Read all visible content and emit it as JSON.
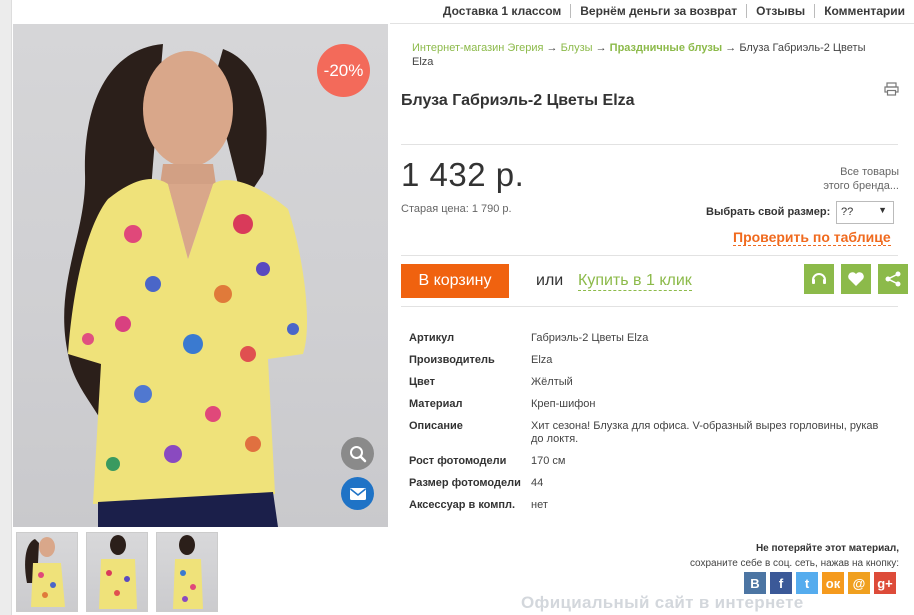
{
  "top_nav": {
    "items": [
      "Доставка 1 классом",
      "Вернём деньги за возврат",
      "Отзывы",
      "Комментарии"
    ]
  },
  "product_image": {
    "discount_badge": "-20%",
    "zoom_icon": "magnifier-icon",
    "mail_icon": "envelope-icon"
  },
  "breadcrumb": {
    "items": [
      "Интернет-магазин Эгерия",
      "Блузы",
      "Праздничные блузы",
      "Блуза Габриэль-2 Цветы"
    ],
    "tail": "Elza",
    "separator": "→"
  },
  "product": {
    "title": "Блуза Габриэль-2 Цветы Elza",
    "price": "1 432 р.",
    "old_price": "Старая цена: 1 790 р.",
    "all_goods_line1": "Все товары",
    "all_goods_line2": "этого бренда...",
    "size_label": "Выбрать свой размер:",
    "size_value": "??",
    "check_table": "Проверить по таблице",
    "cart_button": "В корзину",
    "or_text": "или",
    "one_click": "Купить в 1 клик"
  },
  "specs": [
    {
      "key": "Артикул",
      "value": "Габриэль-2 Цветы Elza"
    },
    {
      "key": "Производитель",
      "value": "Elza"
    },
    {
      "key": "Цвет",
      "value": "Жёлтый"
    },
    {
      "key": "Материал",
      "value": "Креп-шифон"
    },
    {
      "key": "Описание",
      "value": "Хит сезона! Блузка для офиса. V-образный вырез горловины, рукав до локтя."
    },
    {
      "key": "Рост фотомодели",
      "value": "170 см"
    },
    {
      "key": "Размер фотомодели",
      "value": "44"
    },
    {
      "key": "Аксессуар в компл.",
      "value": "нет"
    }
  ],
  "share": {
    "line1": "Не потеряйте этот материал,",
    "line2": "сохраните себе в соц. сеть, нажав на кнопку:",
    "buttons": [
      {
        "label": "В",
        "color": "#4c75a3"
      },
      {
        "label": "f",
        "color": "#3b5998"
      },
      {
        "label": "t",
        "color": "#55acee"
      },
      {
        "label": "ок",
        "color": "#f59a1d"
      },
      {
        "label": "@",
        "color": "#f0a020"
      },
      {
        "label": "g+",
        "color": "#dd4b39"
      }
    ]
  },
  "watermark": "Официальный сайт в интернете Siteofficial.ru",
  "colors": {
    "accent_orange": "#f0620f",
    "accent_green": "#8cba4a",
    "badge_red": "#f36a5a"
  }
}
